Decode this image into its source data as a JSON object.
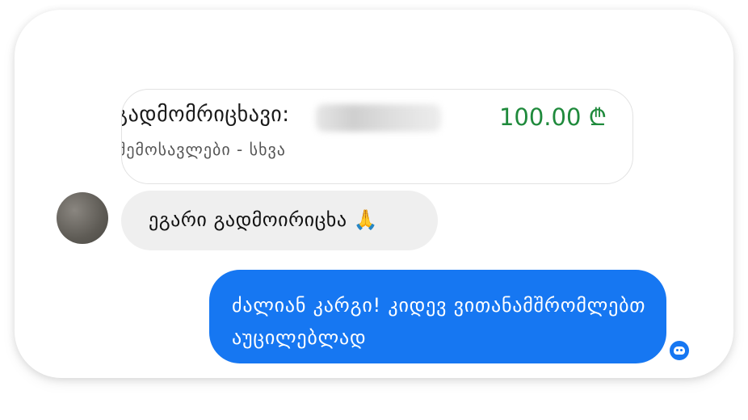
{
  "transaction": {
    "sender_label": "გადმომრიცხავი:",
    "amount": "100.00 ₾",
    "category": "შემოსავლები - სხვა"
  },
  "incoming_message": {
    "text": "ეგარი გადმოირიცხა 🙏"
  },
  "outgoing_message": {
    "text": "ძალიან კარგი! კიდევ ვითანამშრომლებთ აუცილებლად"
  },
  "colors": {
    "accent_blue": "#1677f2",
    "amount_green": "#1f8a3c",
    "incoming_bubble": "#efefef"
  },
  "icons": {
    "seen_indicator": "seen-avatar-icon"
  }
}
